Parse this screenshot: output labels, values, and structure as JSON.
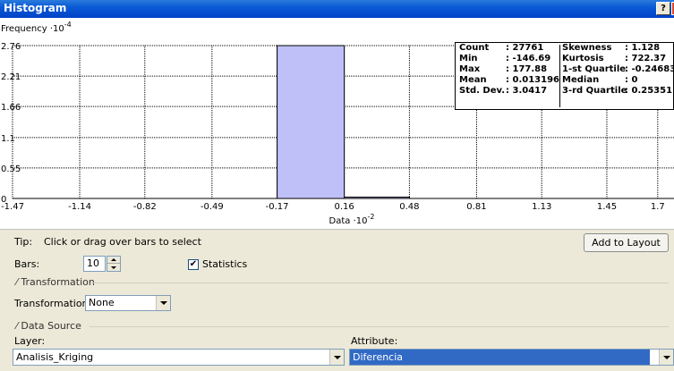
{
  "window": {
    "title": "Histogram",
    "help_label": "?"
  },
  "chart_data": {
    "type": "bar",
    "ylabel": "Frequency",
    "y_exponent": "-4",
    "xlabel": "Data",
    "x_exponent": "-2",
    "x_ticks": [
      "-1.47",
      "-1.14",
      "-0.82",
      "-0.49",
      "-0.17",
      "0.16",
      "0.48",
      "0.81",
      "1.13",
      "1.45",
      "1.7"
    ],
    "y_ticks": [
      "0",
      "0.55",
      "1.1",
      "1.66",
      "2.21",
      "2.76"
    ],
    "bins": [
      {
        "from": -1.47,
        "to": -0.17,
        "value": 0
      },
      {
        "from": -0.17,
        "to": 0.16,
        "value": 2.76
      },
      {
        "from": 0.16,
        "to": 0.48,
        "value": 0.01
      },
      {
        "from": 0.48,
        "to": 1.78,
        "value": 0
      }
    ],
    "xlim": [
      -1.47,
      1.78
    ],
    "ylim": [
      0,
      2.76
    ],
    "grid": true,
    "bar_color": "#c0c0f8"
  },
  "stats": {
    "left": [
      {
        "label": "Count",
        "value": ": 27761"
      },
      {
        "label": "Min",
        "value": ": -146.69"
      },
      {
        "label": "Max",
        "value": ": 177.88"
      },
      {
        "label": "Mean",
        "value": ": 0.013196"
      },
      {
        "label": "Std. Dev.",
        "value": ": 3.0417"
      }
    ],
    "right": [
      {
        "label": "Skewness",
        "value": ": 1.128"
      },
      {
        "label": "Kurtosis",
        "value": ": 722.37"
      },
      {
        "label": "1-st Quartile",
        "value": ": -0.24683"
      },
      {
        "label": "Median",
        "value": ": 0"
      },
      {
        "label": "3-rd Quartile",
        "value": ": 0.25351"
      }
    ]
  },
  "controls": {
    "tip_label": "Tip:",
    "tip_text": "Click or drag over bars to select",
    "add_to_layout": "Add to Layout",
    "bars_label": "Bars:",
    "bars_value": "10",
    "statistics_label": "Statistics",
    "statistics_checked": "✔",
    "transformation_group": "Transformation",
    "transformation_label": "Transformation:",
    "transformation_value": "None",
    "data_source_group": "Data Source",
    "layer_label": "Layer:",
    "layer_value": "Analisis_Kriging",
    "attribute_label": "Attribute:",
    "attribute_value": "Diferencia"
  }
}
